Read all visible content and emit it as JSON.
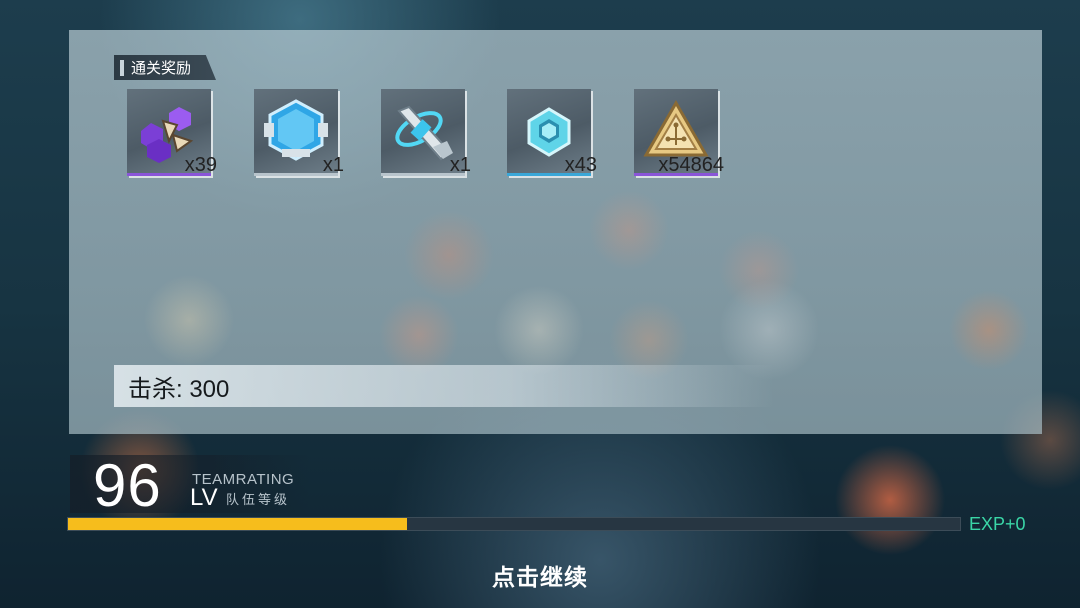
{
  "rewards": {
    "title": "通关奖励",
    "items": [
      {
        "name": "purple-hex-material",
        "count": "x39"
      },
      {
        "name": "blue-chip-module",
        "count": "x1"
      },
      {
        "name": "weapon-part",
        "count": "x1"
      },
      {
        "name": "cyan-hex-crystal",
        "count": "x43"
      },
      {
        "name": "gold-triangle-coin",
        "count": "x54864"
      }
    ]
  },
  "kills": {
    "label": "击杀: 300"
  },
  "team": {
    "level": "96",
    "lv_label": "LV",
    "rating_en": "TEAMRATING",
    "rating_cn": "队伍等级",
    "exp_progress": 0.38,
    "exp_text": "EXP+0"
  },
  "prompt": {
    "continue": "点击继续"
  },
  "colors": {
    "exp_fill": "#f6bd1c",
    "exp_text": "#3ad6a7",
    "rarity_purple": "#8a55d8",
    "rarity_blue": "#3aa7d8"
  }
}
